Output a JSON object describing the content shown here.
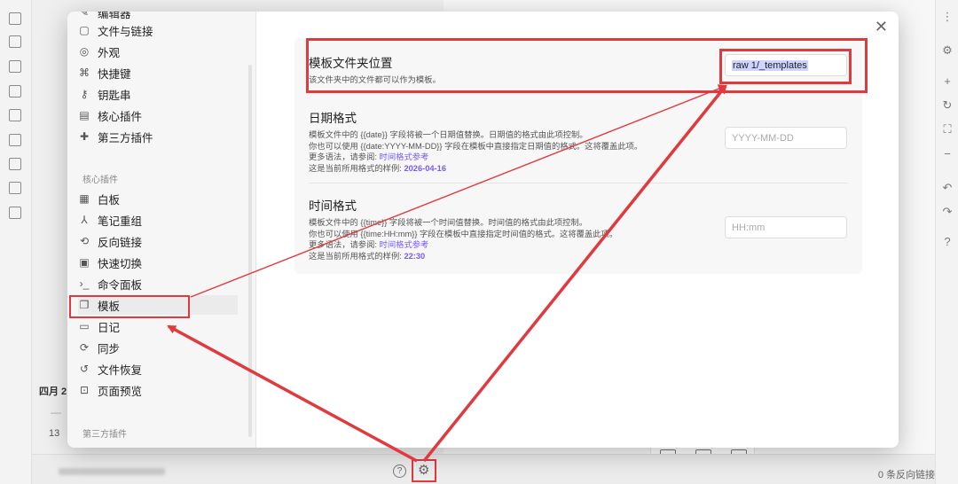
{
  "sidebar": {
    "options_items": [
      {
        "label": "编辑器",
        "icon": "edit-icon"
      },
      {
        "label": "文件与链接",
        "icon": "folder-link-icon"
      },
      {
        "label": "外观",
        "icon": "palette-icon"
      },
      {
        "label": "快捷键",
        "icon": "command-key-icon"
      },
      {
        "label": "钥匙串",
        "icon": "key-icon"
      },
      {
        "label": "核心插件",
        "icon": "calendar-box-icon"
      },
      {
        "label": "第三方插件",
        "icon": "puzzle-icon"
      }
    ],
    "core_plugins_label": "核心插件",
    "core_plugins": [
      {
        "label": "白板",
        "icon": "grid-icon"
      },
      {
        "label": "笔记重组",
        "icon": "merge-icon"
      },
      {
        "label": "反向链接",
        "icon": "backlink-icon"
      },
      {
        "label": "快速切换",
        "icon": "quick-switch-icon"
      },
      {
        "label": "命令面板",
        "icon": "terminal-icon"
      },
      {
        "label": "模板",
        "icon": "template-icon",
        "active": true
      },
      {
        "label": "日记",
        "icon": "calendar-icon"
      },
      {
        "label": "同步",
        "icon": "sync-icon"
      },
      {
        "label": "文件恢复",
        "icon": "history-icon"
      },
      {
        "label": "页面预览",
        "icon": "preview-icon"
      }
    ],
    "third_party_label": "第三方插件"
  },
  "settings": {
    "folder": {
      "title": "模板文件夹位置",
      "desc": "该文件夹中的文件都可以作为模板。",
      "value": "raw 1/_templates"
    },
    "date": {
      "title": "日期格式",
      "desc1": "模板文件中的 {{date}} 字段将被一个日期值替换。日期值的格式由此项控制。",
      "desc2": "你也可以使用 {{date:YYYY-MM-DD}} 字段在模板中直接指定日期值的格式。这将覆盖此项。",
      "more_prefix": "更多语法，请参阅: ",
      "more_link": "时间格式参考",
      "sample_prefix": "这是当前所用格式的样例: ",
      "sample_value": "2026-04-16",
      "placeholder": "YYYY-MM-DD"
    },
    "time": {
      "title": "时间格式",
      "desc1": "模板文件中的 {{time}} 字段将被一个时间值替换。时间值的格式由此项控制。",
      "desc2": "你也可以使用 {{time:HH:mm}} 字段在模板中直接指定时间值的格式。这将覆盖此项。",
      "more_prefix": "更多语法，请参阅: ",
      "more_link": "时间格式参考",
      "sample_prefix": "这是当前所用格式的样例: ",
      "sample_value": "22:30",
      "placeholder": "HH:mm"
    }
  },
  "background": {
    "calendar_month": "四月 2",
    "calendar_dash": "—",
    "calendar_day": "13",
    "backlinks": "0 条反向链接",
    "help_glyph": "?"
  },
  "colors": {
    "accent": "#7a5af8",
    "highlight_box": "#e0393e"
  }
}
